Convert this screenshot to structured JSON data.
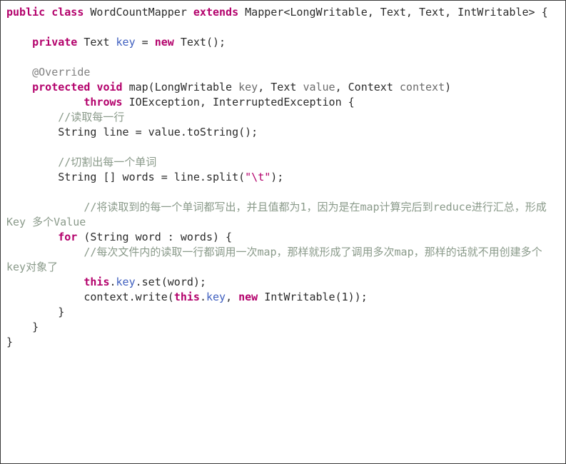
{
  "document": {
    "kind": "source-code-listing",
    "language": "Java",
    "class_name": "WordCountMapper",
    "background_color": "#ffffff",
    "border_color": "#3a3a3a",
    "colors": {
      "keyword": "#b3006b",
      "annotation": "#808080",
      "field": "#3f5fbf",
      "parameter": "#6b6b6b",
      "string": "#b3006b",
      "comment": "#8a9a8a",
      "text": "#2b2b2b"
    }
  },
  "code": {
    "lines": [
      {
        "id": "line-1",
        "indent": "",
        "tokens": [
          {
            "t": "kw",
            "v": "public"
          },
          {
            "t": "pun",
            "v": " "
          },
          {
            "t": "kw",
            "v": "class"
          },
          {
            "t": "pun",
            "v": " "
          },
          {
            "t": "typ",
            "v": "WordCountMapper"
          },
          {
            "t": "pun",
            "v": " "
          },
          {
            "t": "kw",
            "v": "extends"
          },
          {
            "t": "pun",
            "v": " "
          },
          {
            "t": "typ",
            "v": "Mapper<LongWritable, Text, Text, IntWritable> {"
          }
        ]
      },
      {
        "id": "line-2",
        "indent": "",
        "tokens": []
      },
      {
        "id": "line-3",
        "indent": "    ",
        "tokens": [
          {
            "t": "kw",
            "v": "private"
          },
          {
            "t": "pun",
            "v": " "
          },
          {
            "t": "typ",
            "v": "Text"
          },
          {
            "t": "pun",
            "v": " "
          },
          {
            "t": "fld",
            "v": "key"
          },
          {
            "t": "pun",
            "v": " = "
          },
          {
            "t": "kw",
            "v": "new"
          },
          {
            "t": "pun",
            "v": " "
          },
          {
            "t": "typ",
            "v": "Text();"
          }
        ]
      },
      {
        "id": "line-4",
        "indent": "",
        "tokens": []
      },
      {
        "id": "line-5",
        "indent": "    ",
        "tokens": [
          {
            "t": "ann",
            "v": "@Override"
          }
        ]
      },
      {
        "id": "line-6",
        "indent": "    ",
        "tokens": [
          {
            "t": "kw",
            "v": "protected"
          },
          {
            "t": "pun",
            "v": " "
          },
          {
            "t": "kw",
            "v": "void"
          },
          {
            "t": "pun",
            "v": " "
          },
          {
            "t": "typ",
            "v": "map(LongWritable "
          },
          {
            "t": "par",
            "v": "key"
          },
          {
            "t": "typ",
            "v": ", Text "
          },
          {
            "t": "par",
            "v": "value"
          },
          {
            "t": "typ",
            "v": ", Context "
          },
          {
            "t": "par",
            "v": "context"
          },
          {
            "t": "typ",
            "v": ")"
          }
        ]
      },
      {
        "id": "line-7",
        "indent": "            ",
        "tokens": [
          {
            "t": "kw",
            "v": "throws"
          },
          {
            "t": "pun",
            "v": " "
          },
          {
            "t": "typ",
            "v": "IOException, InterruptedException {"
          }
        ]
      },
      {
        "id": "line-8",
        "indent": "        ",
        "tokens": [
          {
            "t": "cmt",
            "v": "//读取每一行"
          }
        ]
      },
      {
        "id": "line-9",
        "indent": "        ",
        "tokens": [
          {
            "t": "typ",
            "v": "String line = value.toString();"
          }
        ]
      },
      {
        "id": "line-10",
        "indent": "",
        "tokens": []
      },
      {
        "id": "line-11",
        "indent": "        ",
        "tokens": [
          {
            "t": "cmt",
            "v": "//切割出每一个单词"
          }
        ]
      },
      {
        "id": "line-12",
        "indent": "        ",
        "tokens": [
          {
            "t": "typ",
            "v": "String [] words = line.split("
          },
          {
            "t": "str",
            "v": "\"\\t\""
          },
          {
            "t": "typ",
            "v": ");"
          }
        ]
      },
      {
        "id": "line-13",
        "indent": "",
        "tokens": []
      },
      {
        "id": "line-14",
        "indent": "            ",
        "tokens": [
          {
            "t": "cmt",
            "v": "//将读取到的每一个单词都写出，并且值都为1，因为是在map计算完后到reduce进行汇总，形成Key 多个Value"
          }
        ]
      },
      {
        "id": "line-15",
        "indent": "        ",
        "tokens": [
          {
            "t": "kw",
            "v": "for"
          },
          {
            "t": "pun",
            "v": " "
          },
          {
            "t": "typ",
            "v": "(String word : words) {"
          }
        ]
      },
      {
        "id": "line-16",
        "indent": "            ",
        "tokens": [
          {
            "t": "cmt",
            "v": "//每次文件内的读取一行都调用一次map，那样就形成了调用多次map，那样的话就不用创建多个key对象了"
          }
        ]
      },
      {
        "id": "line-17",
        "indent": "            ",
        "tokens": [
          {
            "t": "kw",
            "v": "this"
          },
          {
            "t": "pun",
            "v": "."
          },
          {
            "t": "fld",
            "v": "key"
          },
          {
            "t": "typ",
            "v": ".set(word);"
          }
        ]
      },
      {
        "id": "line-18",
        "indent": "            ",
        "tokens": [
          {
            "t": "typ",
            "v": "context.write("
          },
          {
            "t": "kw",
            "v": "this"
          },
          {
            "t": "pun",
            "v": "."
          },
          {
            "t": "fld",
            "v": "key"
          },
          {
            "t": "typ",
            "v": ", "
          },
          {
            "t": "kw",
            "v": "new"
          },
          {
            "t": "pun",
            "v": " "
          },
          {
            "t": "typ",
            "v": "IntWritable(1));"
          }
        ]
      },
      {
        "id": "line-19",
        "indent": "        ",
        "tokens": [
          {
            "t": "pun",
            "v": "}"
          }
        ]
      },
      {
        "id": "line-20",
        "indent": "    ",
        "tokens": [
          {
            "t": "pun",
            "v": "}"
          }
        ]
      },
      {
        "id": "line-21",
        "indent": "",
        "tokens": [
          {
            "t": "pun",
            "v": "}"
          }
        ]
      }
    ]
  }
}
